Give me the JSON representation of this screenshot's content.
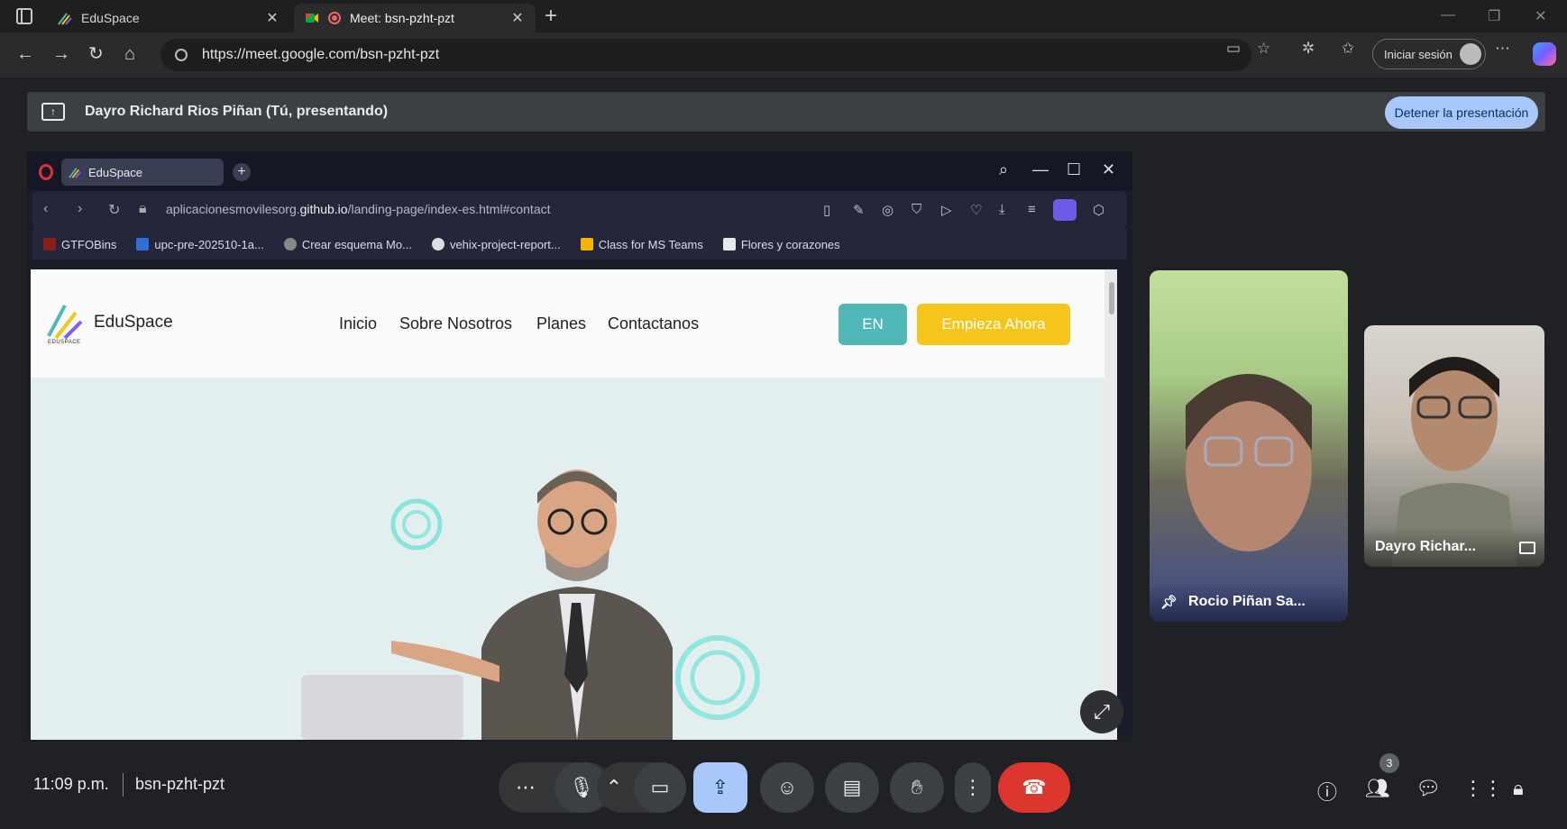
{
  "browser": {
    "tabs": [
      {
        "title": "EduSpace"
      },
      {
        "title": "Meet: bsn-pzht-pzt"
      }
    ],
    "url": "https://meet.google.com/bsn-pzht-pzt",
    "signin_label": "Iniciar sesión"
  },
  "meet": {
    "presenter_banner": "Dayro Richard Rios Piñan (Tú, presentando)",
    "stop_presenting": "Detener la presentación",
    "time": "11:09 p.m.",
    "meeting_code": "bsn-pzht-pzt",
    "participant_count": "3",
    "participants": [
      {
        "name": "Rocio Piñan Sa..."
      },
      {
        "name": "Dayro Richar..."
      }
    ]
  },
  "shared_screen": {
    "tab_title": "EduSpace",
    "url_prefix": "aplicacionesmovilesorg.",
    "url_domain": "github.io",
    "url_path": "/landing-page/index-es.html#contact",
    "bookmarks": [
      "GTFOBins",
      "upc-pre-202510-1a...",
      "Crear esquema Mo...",
      "vehix-project-report...",
      "Class for MS Teams",
      "Flores y corazones"
    ],
    "site": {
      "brand": "EduSpace",
      "brand_small": "EDUSPACE",
      "nav": [
        "Inicio",
        "Sobre Nosotros",
        "Planes",
        "Contactanos"
      ],
      "lang_button": "EN",
      "cta_button": "Empieza Ahora"
    }
  },
  "colors": {
    "meet_bg": "#202124",
    "stop_btn": "#a8c7fa",
    "hangup": "#dc362e",
    "site_teal": "#4fb8b6",
    "site_yellow": "#f4c51b"
  }
}
